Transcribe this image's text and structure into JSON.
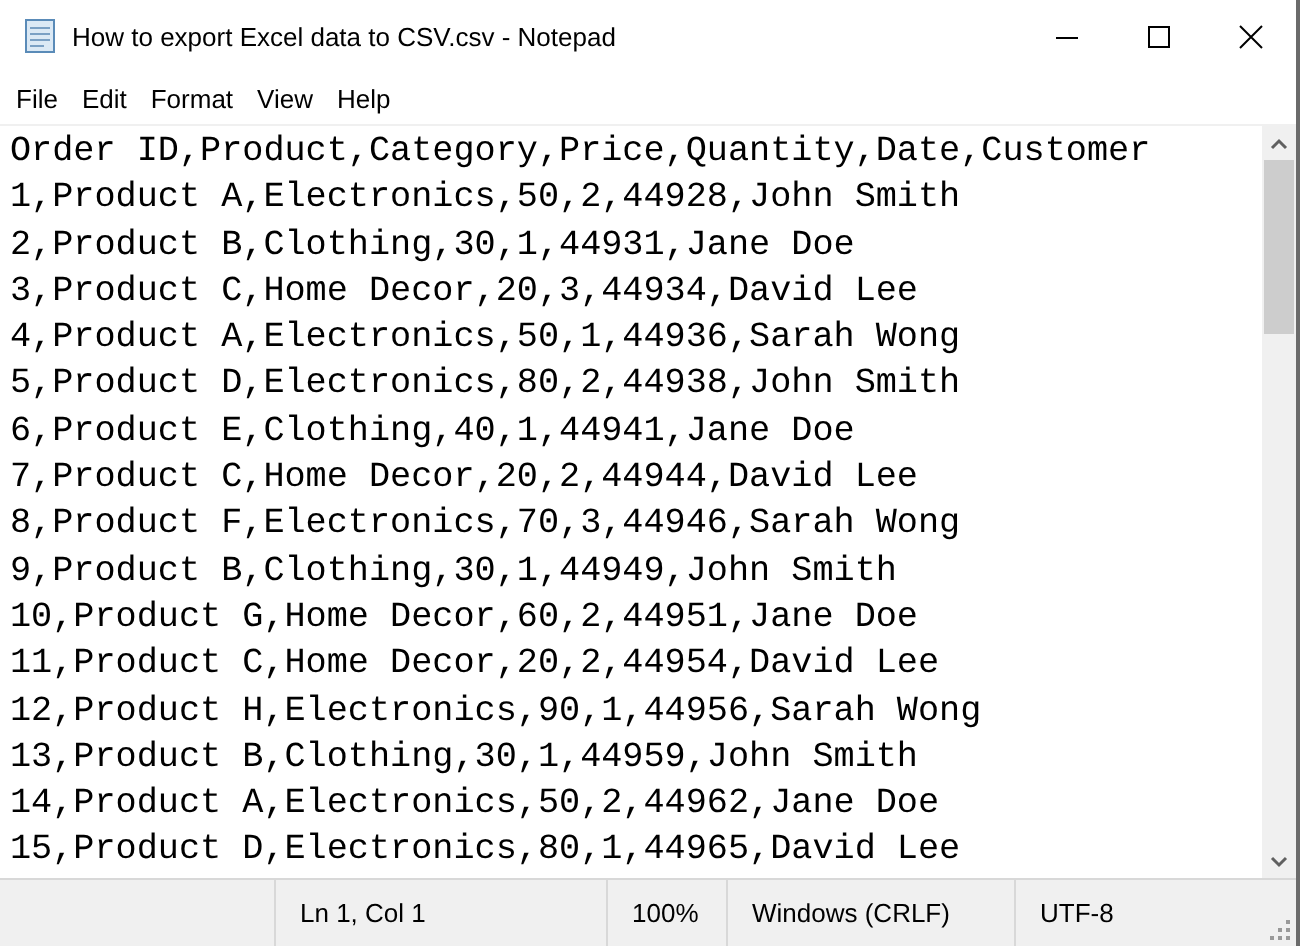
{
  "window": {
    "title": "How to export Excel data to CSV.csv - Notepad"
  },
  "menu": [
    "File",
    "Edit",
    "Format",
    "View",
    "Help"
  ],
  "lines": [
    "Order ID,Product,Category,Price,Quantity,Date,Customer",
    "1,Product A,Electronics,50,2,44928,John Smith",
    "2,Product B,Clothing,30,1,44931,Jane Doe",
    "3,Product C,Home Decor,20,3,44934,David Lee",
    "4,Product A,Electronics,50,1,44936,Sarah Wong",
    "5,Product D,Electronics,80,2,44938,John Smith",
    "6,Product E,Clothing,40,1,44941,Jane Doe",
    "7,Product C,Home Decor,20,2,44944,David Lee",
    "8,Product F,Electronics,70,3,44946,Sarah Wong",
    "9,Product B,Clothing,30,1,44949,John Smith",
    "10,Product G,Home Decor,60,2,44951,Jane Doe",
    "11,Product C,Home Decor,20,2,44954,David Lee",
    "12,Product H,Electronics,90,1,44956,Sarah Wong",
    "13,Product B,Clothing,30,1,44959,John Smith",
    "14,Product A,Electronics,50,2,44962,Jane Doe",
    "15,Product D,Electronics,80,1,44965,David Lee"
  ],
  "status_bar": [
    "Ln 1, Col 1",
    "100%",
    "Windows (CRLF)",
    "UTF-8"
  ]
}
